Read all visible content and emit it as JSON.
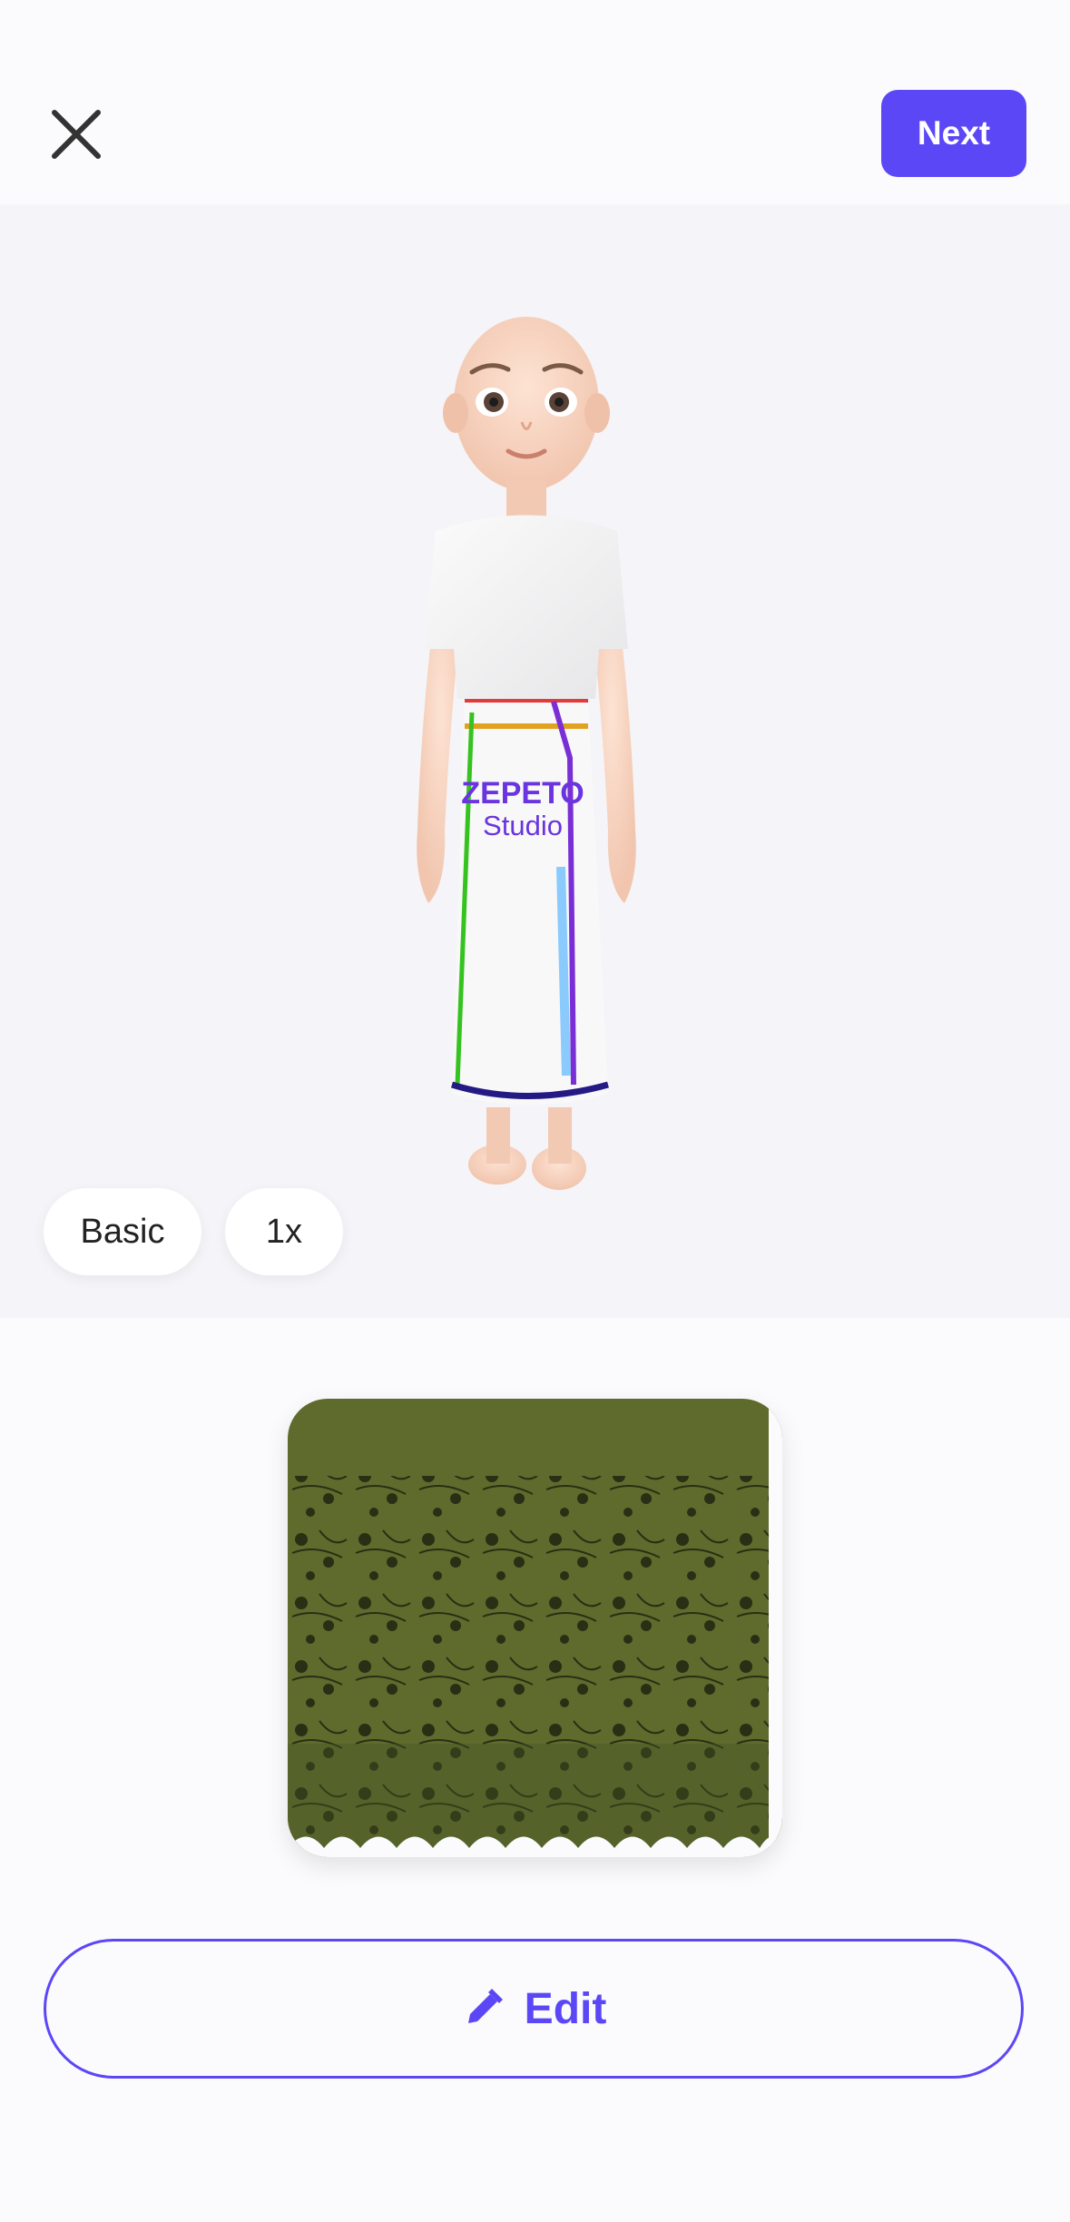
{
  "header": {
    "close_icon": "close-icon",
    "next_label": "Next",
    "accent": "#5c47f7"
  },
  "viewer": {
    "background": "#f5f4f8",
    "logo_line1": "ZEPETO",
    "logo_line2": "Studio",
    "pose_label": "Basic",
    "zoom_label": "1x"
  },
  "texture": {
    "description_icon": "floral-texture-thumbnail",
    "fabric_color": "#5e6b2c"
  },
  "footer": {
    "edit_label": "Edit",
    "edit_icon": "pencil-icon"
  }
}
